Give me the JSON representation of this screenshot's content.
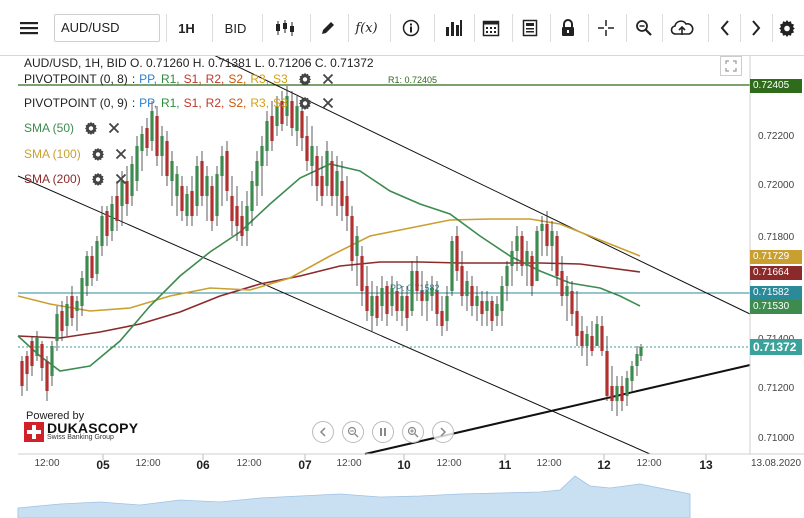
{
  "toolbar": {
    "symbol": "AUD/USD",
    "timeframe": "1H",
    "price_side": "BID",
    "buttons": [
      "menu-icon",
      "candlestick-icon",
      "draw-pencil-icon",
      "fx-icon",
      "info-icon",
      "bar-chart-icon",
      "calendar-icon",
      "news-icon",
      "lock-icon",
      "crosshair-icon",
      "zoom-icon",
      "cloud-upload-icon",
      "arrow-left-icon",
      "arrow-right-icon",
      "gear-icon"
    ],
    "fx_label": "f(x)"
  },
  "chart": {
    "ohlc": "AUD/USD, 1H, BID   O. 0.71260 H. 0.71381 L. 0.71206 C. 0.71372",
    "legends": [
      {
        "name": "PIVOTPOINT (0, 8)",
        "items": [
          "PP",
          "R1",
          "S1",
          "R2",
          "S2",
          "R3",
          "S3"
        ],
        "color": "#222"
      },
      {
        "name": "PIVOTPOINT (0, 9)",
        "items": [
          "PP",
          "R1",
          "S1",
          "R2",
          "S2",
          "R3",
          "S3"
        ],
        "color": "#222"
      },
      {
        "name": "SMA (50)",
        "color": "#3d8b4f"
      },
      {
        "name": "SMA (100)",
        "color": "#c9a030"
      },
      {
        "name": "SMA (200)",
        "color": "#8b2a2a"
      }
    ],
    "pivot_colors": {
      "PP": "#2a7fd1",
      "R1": "#2e8b3a",
      "S1": "#c0392b",
      "R2": "#c0392b",
      "S2": "#d35400",
      "R3": "#d4a017",
      "S3": "#d4a017"
    },
    "pivot_r1_label": "R1: 0.72405",
    "pivot_pp_label": "PP: 0.71582",
    "price_ticks": [
      "0.72200",
      "0.72000",
      "0.71800",
      "0.71400",
      "0.71200",
      "0.71000"
    ],
    "badges": [
      {
        "text": "0.72405",
        "color": "#2e6b1a"
      },
      {
        "text": "0.71729",
        "color": "#c9a030"
      },
      {
        "text": "0.71664",
        "color": "#8b2a2a"
      },
      {
        "text": "0.71582",
        "color": "#2a8a9a"
      },
      {
        "text": "0.71530",
        "color": "#3d8b4f"
      },
      {
        "text": "0.71372",
        "color": "#3aa29a"
      }
    ],
    "time_labels": [
      {
        "text": "12:00",
        "day": false
      },
      {
        "text": "05",
        "day": true
      },
      {
        "text": "12:00",
        "day": false
      },
      {
        "text": "06",
        "day": true
      },
      {
        "text": "12:00",
        "day": false
      },
      {
        "text": "07",
        "day": true
      },
      {
        "text": "12:00",
        "day": false
      },
      {
        "text": "10",
        "day": true
      },
      {
        "text": "12:00",
        "day": false
      },
      {
        "text": "11",
        "day": true
      },
      {
        "text": "12:00",
        "day": false
      },
      {
        "text": "12",
        "day": true
      },
      {
        "text": "12:00",
        "day": false
      },
      {
        "text": "13",
        "day": true
      }
    ],
    "date_label": "13.08.2020",
    "powered_by": "Powered by",
    "brand": "DUKASCOPY",
    "brand_sub": "Swiss Banking Group",
    "nav_buttons": [
      "chevron-left-icon",
      "zoom-out-icon",
      "pause-icon",
      "zoom-in-icon",
      "chevron-right-icon"
    ]
  }
}
